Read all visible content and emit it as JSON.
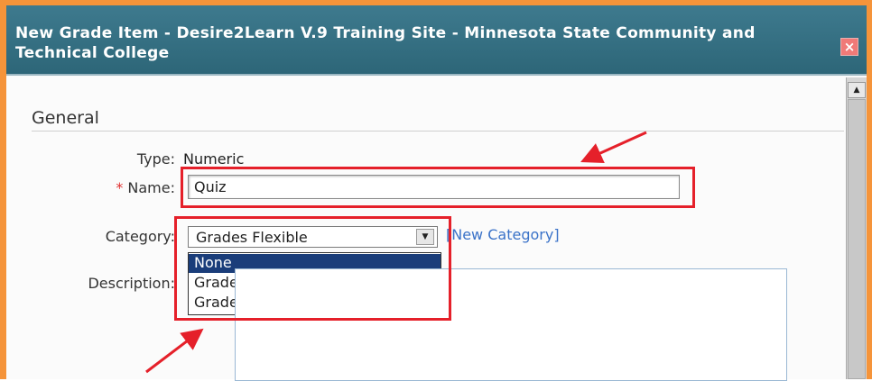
{
  "dialog": {
    "title": "New Grade Item - Desire2Learn V.9 Training Site - Minnesota State Community and Technical College",
    "close_icon": "close-icon"
  },
  "section": {
    "title": "General"
  },
  "form": {
    "type_label": "Type:",
    "type_value": "Numeric",
    "required_marker": "*",
    "name_label": "Name:",
    "name_value": "Quiz",
    "category_label": "Category:",
    "category_value": "Grades Flexible",
    "new_category_link": "[New Category]",
    "description_label": "Description:",
    "category_options": [
      "None",
      "Grade Item for the quiz",
      "Grades Flexible"
    ],
    "category_highlighted_option": "None"
  },
  "annotations": {
    "color": "#e5202a"
  },
  "colors": {
    "border_accent": "#f5943a",
    "titlebar": "#2d6678",
    "dropdown_highlight": "#1a3d7a",
    "link": "#3a72c8"
  }
}
